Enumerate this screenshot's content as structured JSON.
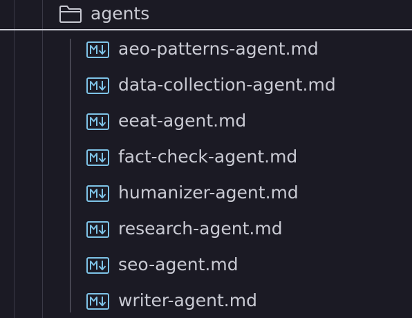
{
  "folder": {
    "name": "agents",
    "icon": "folder-icon"
  },
  "files": [
    {
      "name": "aeo-patterns-agent.md",
      "icon": "markdown-icon"
    },
    {
      "name": "data-collection-agent.md",
      "icon": "markdown-icon"
    },
    {
      "name": "eeat-agent.md",
      "icon": "markdown-icon"
    },
    {
      "name": "fact-check-agent.md",
      "icon": "markdown-icon"
    },
    {
      "name": "humanizer-agent.md",
      "icon": "markdown-icon"
    },
    {
      "name": "research-agent.md",
      "icon": "markdown-icon"
    },
    {
      "name": "seo-agent.md",
      "icon": "markdown-icon"
    },
    {
      "name": "writer-agent.md",
      "icon": "markdown-icon"
    }
  ],
  "colors": {
    "background": "#1b1a24",
    "text": "#c9cad3",
    "markdown_icon": "#7fc4e8",
    "folder_icon": "#c9cad3"
  }
}
